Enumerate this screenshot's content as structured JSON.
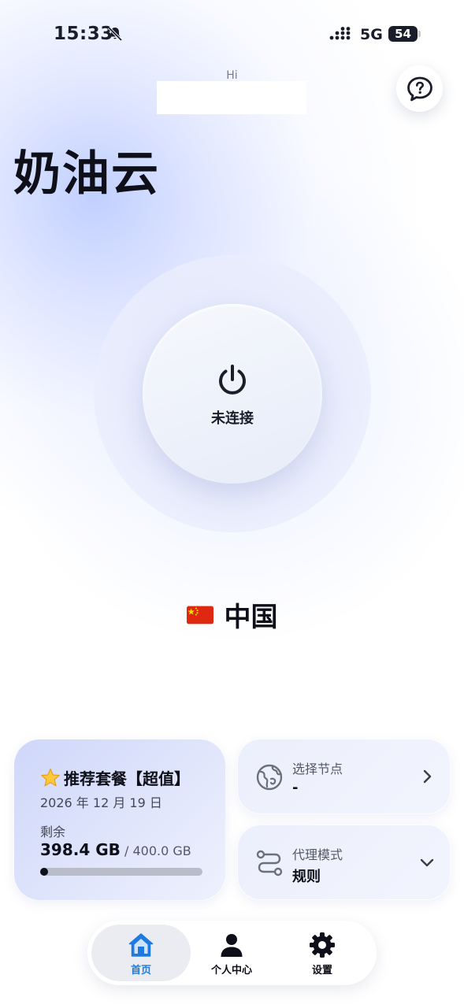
{
  "status_bar": {
    "time": "15:33",
    "network": "5G",
    "battery": "54",
    "battery_level": 0.54
  },
  "header": {
    "greeting": "Hi",
    "app_title": "奶油云"
  },
  "connection": {
    "status": "未连接"
  },
  "location": {
    "country": "中国",
    "flag": "CN"
  },
  "plan": {
    "name": "推荐套餐【超值】",
    "expiry": "2026 年 12 月 19 日",
    "remaining_label": "剩余",
    "remaining": "398.4 GB",
    "total": "/ 400.0 GB",
    "used_fraction": 0.004
  },
  "node": {
    "label": "选择节点",
    "value": "-"
  },
  "proxy_mode": {
    "label": "代理模式",
    "value": "规则"
  },
  "tabs": [
    {
      "label": "首页",
      "icon": "home-icon",
      "active": true
    },
    {
      "label": "个人中心",
      "icon": "person-icon",
      "active": false
    },
    {
      "label": "设置",
      "icon": "gear-icon",
      "active": false
    }
  ],
  "colors": {
    "accent": "#1f7ae0",
    "text": "#0e0f18"
  }
}
